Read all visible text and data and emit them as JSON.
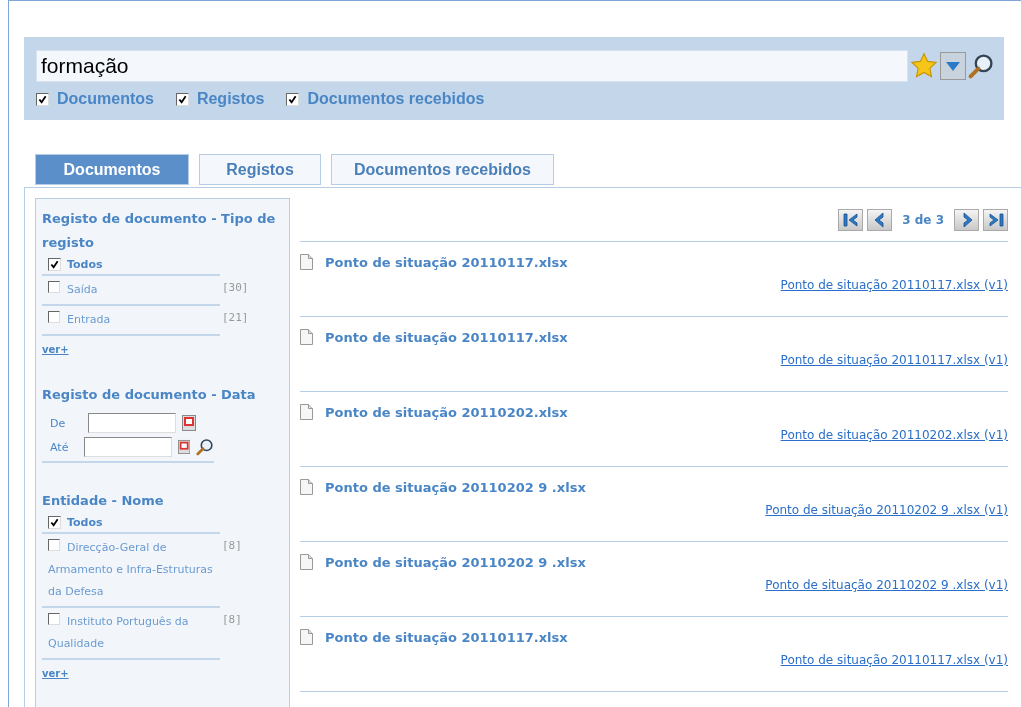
{
  "search": {
    "value": "formação",
    "scopes": [
      {
        "label": "Documentos",
        "checked": true
      },
      {
        "label": "Registos",
        "checked": true
      },
      {
        "label": "Documentos recebidos",
        "checked": true
      }
    ]
  },
  "tabs": [
    {
      "label": "Documentos",
      "selected": true
    },
    {
      "label": "Registos",
      "selected": false
    },
    {
      "label": "Documentos recebidos",
      "selected": false
    }
  ],
  "facets": [
    {
      "kind": "list",
      "title": "Registo de documento - Tipo de registo",
      "all": {
        "label": "Todos",
        "checked": true
      },
      "items": [
        {
          "label": "Saída",
          "count": "[30]",
          "checked": false
        },
        {
          "label": "Entrada",
          "count": "[21]",
          "checked": false
        }
      ],
      "more": "ver+"
    },
    {
      "kind": "date",
      "title": "Registo de documento - Data",
      "from_label": "De",
      "to_label": "Até"
    },
    {
      "kind": "list",
      "title": "Entidade - Nome",
      "all": {
        "label": "Todos",
        "checked": true
      },
      "items": [
        {
          "label": "Direcção-Geral de Armamento e Infra-Estruturas da Defesa",
          "count": "[8]",
          "checked": false
        },
        {
          "label": "Instituto Português da Qualidade",
          "count": "[8]",
          "checked": false
        }
      ],
      "more": "ver+"
    }
  ],
  "pager": {
    "label": "3 de 3"
  },
  "results": [
    {
      "title": "Ponto de situação 20110117.xlsx",
      "link": "Ponto de situação 20110117.xlsx (v1)"
    },
    {
      "title": "Ponto de situação 20110117.xlsx",
      "link": "Ponto de situação 20110117.xlsx (v1)"
    },
    {
      "title": "Ponto de situação 20110202.xlsx",
      "link": "Ponto de situação 20110202.xlsx (v1)"
    },
    {
      "title": "Ponto de situação 20110202 9 .xlsx",
      "link": "Ponto de situação 20110202 9 .xlsx (v1)"
    },
    {
      "title": "Ponto de situação 20110202 9 .xlsx",
      "link": "Ponto de situação 20110202 9 .xlsx (v1)"
    },
    {
      "title": "Ponto de situação 20110117.xlsx",
      "link": "Ponto de situação 20110117.xlsx (v1)"
    }
  ]
}
